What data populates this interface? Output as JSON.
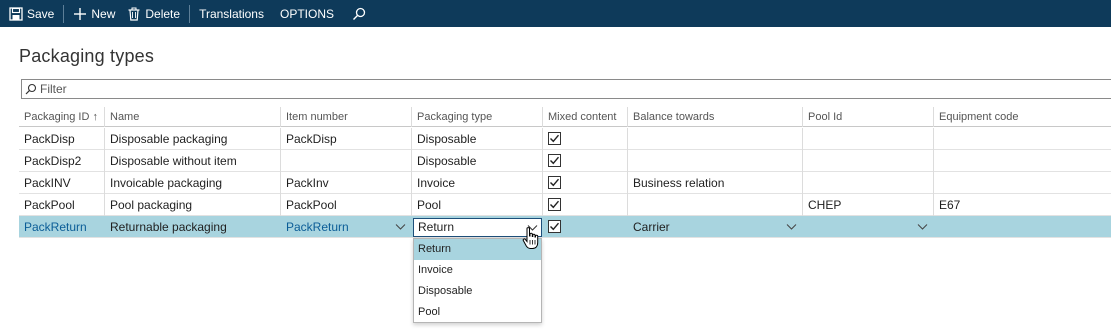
{
  "toolbar": {
    "save": "Save",
    "new": "New",
    "delete": "Delete",
    "translations": "Translations",
    "options": "OPTIONS"
  },
  "page": {
    "title": "Packaging types"
  },
  "filter": {
    "placeholder": "Filter"
  },
  "grid": {
    "headers": [
      "Packaging ID",
      "Name",
      "Item number",
      "Packaging type",
      "Mixed content",
      "Balance towards",
      "Pool Id",
      "Equipment code"
    ],
    "sort_indicator": "↑",
    "rows": [
      {
        "id": "PackDisp",
        "name": "Disposable packaging",
        "item": "PackDisp",
        "type": "Disposable",
        "mixed": true,
        "balance": "",
        "pool": "",
        "equipment": ""
      },
      {
        "id": "PackDisp2",
        "name": "Disposable without item",
        "item": "",
        "type": "Disposable",
        "mixed": true,
        "balance": "",
        "pool": "",
        "equipment": ""
      },
      {
        "id": "PackINV",
        "name": "Invoicable packaging",
        "item": "PackInv",
        "type": "Invoice",
        "mixed": true,
        "balance": "Business relation",
        "pool": "",
        "equipment": ""
      },
      {
        "id": "PackPool",
        "name": "Pool packaging",
        "item": "PackPool",
        "type": "Pool",
        "mixed": true,
        "balance": "",
        "pool": "CHEP",
        "equipment": "E67"
      },
      {
        "id": "PackReturn",
        "name": "Returnable packaging",
        "item": "PackReturn",
        "type": "Return",
        "mixed": true,
        "balance": "Carrier",
        "pool": "",
        "equipment": ""
      }
    ]
  },
  "dropdown": {
    "options": [
      "Return",
      "Invoice",
      "Disposable",
      "Pool"
    ],
    "selected": "Return"
  },
  "colors": {
    "toolbar_bg": "#0e3a5a",
    "selection": "#a8d4df",
    "link": "#0b5d97"
  }
}
